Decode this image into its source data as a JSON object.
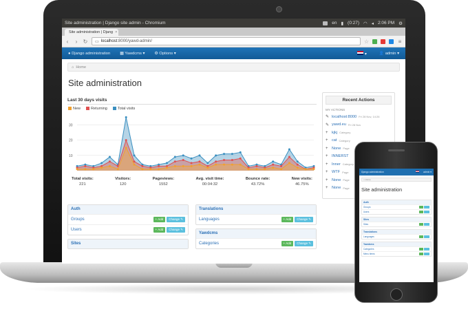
{
  "os_bar": {
    "title": "Site administration | Django site admin - Chromium",
    "tray_label": "en",
    "clock": "2:06 PM",
    "battery": "(0:27)"
  },
  "browser": {
    "tab_title": "Site administration | Djang",
    "tab_close": "×",
    "url_host": "localhost",
    "url_path": ":8000/yawd-admin/",
    "back": "‹",
    "forward": "›",
    "reload": "↻"
  },
  "nav": {
    "brand": "Django administration",
    "menu1": "Yawdcms ▾",
    "menu2": "Options ▾",
    "user": "admin ▾"
  },
  "breadcrumb": {
    "home": "Home"
  },
  "page": {
    "title": "Site administration"
  },
  "visits": {
    "title": "Last 30 days visits",
    "legend": [
      {
        "name": "New",
        "color": "#f0a030"
      },
      {
        "name": "Returning",
        "color": "#e05050"
      },
      {
        "name": "Total visits",
        "color": "#3a8fc0"
      }
    ],
    "stats": [
      {
        "label": "Total visits:",
        "value": "221"
      },
      {
        "label": "Visitors:",
        "value": "120"
      },
      {
        "label": "Pageviews:",
        "value": "1552"
      },
      {
        "label": "Avg. visit time:",
        "value": "00:04:32"
      },
      {
        "label": "Bounce rate:",
        "value": "43.72%"
      },
      {
        "label": "New visits:",
        "value": "46.75%"
      }
    ]
  },
  "chart_data": {
    "type": "area",
    "x": [
      1,
      2,
      3,
      4,
      5,
      6,
      7,
      8,
      9,
      10,
      11,
      12,
      13,
      14,
      15,
      16,
      17,
      18,
      19,
      20,
      21,
      22,
      23,
      24,
      25,
      26,
      27,
      28,
      29,
      30
    ],
    "yticks": [
      "30",
      "20",
      "10"
    ],
    "ylim": [
      0,
      37
    ],
    "series": [
      {
        "name": "Total visits",
        "values": [
          3,
          4,
          3,
          5,
          9,
          4,
          35,
          10,
          4,
          3,
          4,
          5,
          9,
          10,
          8,
          10,
          5,
          10,
          11,
          11,
          12,
          3,
          4,
          3,
          6,
          4,
          14,
          6,
          2,
          3
        ]
      },
      {
        "name": "Returning",
        "values": [
          2,
          3,
          2,
          3,
          6,
          3,
          20,
          6,
          3,
          2,
          3,
          3,
          6,
          7,
          5,
          6,
          3,
          6,
          7,
          7,
          8,
          2,
          3,
          2,
          4,
          3,
          9,
          4,
          1,
          2
        ]
      },
      {
        "name": "New",
        "values": [
          1,
          1,
          1,
          2,
          3,
          1,
          15,
          4,
          1,
          1,
          1,
          2,
          3,
          3,
          3,
          4,
          2,
          4,
          4,
          4,
          4,
          1,
          1,
          1,
          2,
          1,
          5,
          2,
          1,
          1
        ]
      }
    ]
  },
  "recent": {
    "title": "Recent Actions",
    "subtitle": "MY ACTIONS",
    "items": [
      {
        "icon": "pencil",
        "label": "localhost:8000",
        "meta": "Fri 28 Nov, 14:26"
      },
      {
        "icon": "pencil",
        "label": "yawd.eu",
        "meta": "Fri 28 Nov"
      },
      {
        "icon": "plus",
        "label": "kjkj",
        "meta": "Category"
      },
      {
        "icon": "plus",
        "label": "cat",
        "meta": "Category"
      },
      {
        "icon": "plus",
        "label": "None",
        "meta": "Page"
      },
      {
        "icon": "plus",
        "label": "INNERST",
        "meta": ""
      },
      {
        "icon": "plus",
        "label": "Inner",
        "meta": "Category"
      },
      {
        "icon": "plus",
        "label": "WTF",
        "meta": "Page"
      },
      {
        "icon": "plus",
        "label": "None",
        "meta": "Page"
      },
      {
        "icon": "plus",
        "label": "None",
        "meta": "Page"
      }
    ]
  },
  "modules": {
    "add_label": "Add",
    "change_label": "Change",
    "auth": {
      "title": "Auth",
      "rows": [
        "Groups",
        "Users"
      ]
    },
    "sites": {
      "title": "Sites"
    },
    "translations": {
      "title": "Translations",
      "rows": [
        "Languages"
      ]
    },
    "yawdcms": {
      "title": "Yawdcms",
      "rows": [
        "Categories"
      ]
    }
  },
  "phone": {
    "brand": "Django administration",
    "user": "admin ▾",
    "breadcrumb": "Home",
    "title": "Site administration",
    "modules": [
      {
        "title": "Auth",
        "rows": [
          "Groups",
          "Users"
        ]
      },
      {
        "title": "Sites",
        "rows": [
          "Sites"
        ]
      },
      {
        "title": "Translations",
        "rows": [
          "Languages"
        ]
      },
      {
        "title": "Yawdcms",
        "rows": [
          "Categories",
          "Menu items"
        ]
      }
    ]
  }
}
